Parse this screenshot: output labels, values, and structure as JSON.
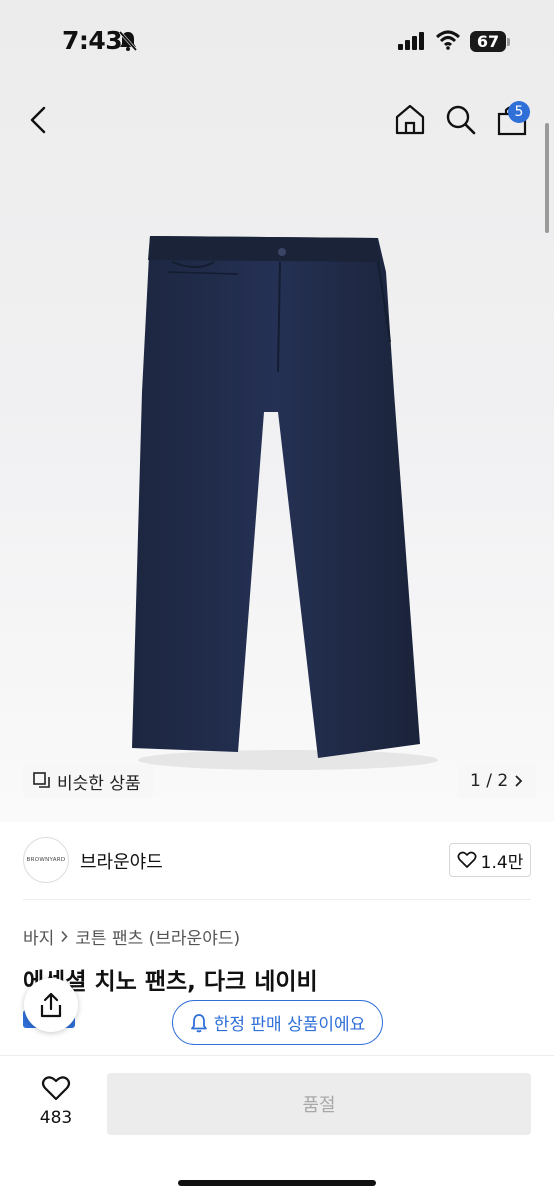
{
  "status_bar": {
    "time": "7:43",
    "battery": "67"
  },
  "header": {
    "cart_count": "5",
    "icons": [
      "back-icon",
      "home-icon",
      "search-icon",
      "bag-icon"
    ]
  },
  "gallery": {
    "similar_label": "비슷한 상품",
    "pager": "1 / 2"
  },
  "brand": {
    "logo_text": "BROWNYARD",
    "name": "브라운야드",
    "likes": "1.4만"
  },
  "product": {
    "breadcrumb": [
      "바지",
      "코튼 팬츠 (브라운야드)"
    ],
    "title": "에센셜 치노 팬츠, 다크 네이비",
    "limited_notice": "한정 판매 상품이에요"
  },
  "bottom_bar": {
    "wish_count": "483",
    "soldout_label": "품절"
  },
  "colors": {
    "accent": "#2f6fd8",
    "product": "#1f2a44",
    "soldout_bg": "#ececec"
  }
}
